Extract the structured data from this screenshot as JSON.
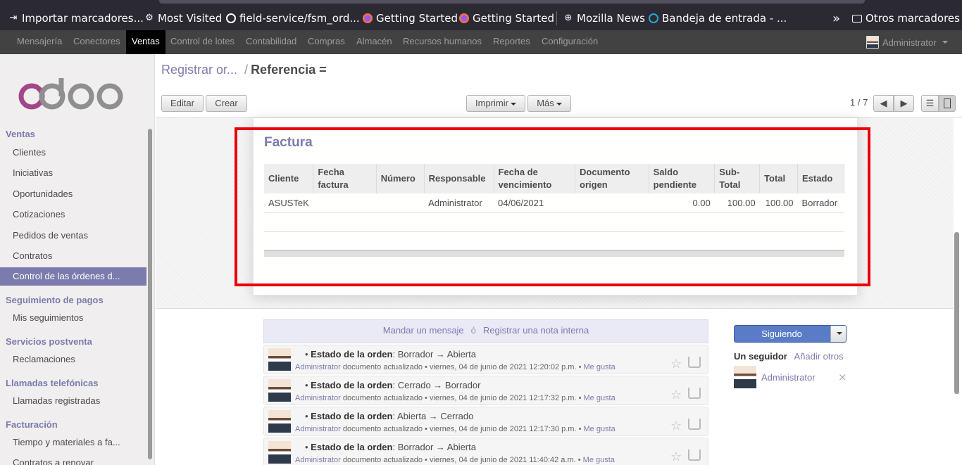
{
  "bookmarks": [
    {
      "label": "Importar marcadores...",
      "icon": "import-icon"
    },
    {
      "label": "Most Visited",
      "icon": "gear-icon"
    },
    {
      "label": "field-service/fsm_ord...",
      "icon": "github-icon"
    },
    {
      "label": "Getting Started",
      "icon": "firefox-icon"
    },
    {
      "label": "Getting Started",
      "icon": "firefox-icon"
    },
    {
      "label": "Mozilla News",
      "icon": "globe-icon"
    },
    {
      "label": "Bandeja de entrada - ...",
      "icon": "mail-icon"
    }
  ],
  "bookmarks_overflow": "»",
  "other_bookmarks": "Otros marcadores",
  "topmenu": [
    "Mensajería",
    "Conectores",
    "Ventas",
    "Control de lotes",
    "Contabilidad",
    "Compras",
    "Almacén",
    "Recursos humanos",
    "Reportes",
    "Configuración"
  ],
  "topmenu_active": "Ventas",
  "user": "Administrator",
  "sidebar": {
    "sections": [
      {
        "title": "Ventas",
        "items": [
          "Clientes",
          "Iniciativas",
          "Oportunidades",
          "Cotizaciones",
          "Pedidos de ventas",
          "Contratos",
          "Control de las órdenes d..."
        ]
      },
      {
        "title": "Seguimiento de pagos",
        "items": [
          "Mis seguimientos"
        ]
      },
      {
        "title": "Servicios postventa",
        "items": [
          "Reclamaciones"
        ]
      },
      {
        "title": "Llamadas telefónicas",
        "items": [
          "Llamadas registradas"
        ]
      },
      {
        "title": "Facturación",
        "items": [
          "Tiempo y materiales a fa...",
          "Contratos a renovar"
        ]
      }
    ],
    "active_item": "Control de las órdenes d..."
  },
  "breadcrumb": {
    "parent": "Registrar or...",
    "sep": "/",
    "current": "Referencia ="
  },
  "buttons": {
    "edit": "Editar",
    "create": "Crear",
    "print": "Imprimir",
    "more": "Más"
  },
  "pager": "1 / 7",
  "invoice": {
    "title": "Factura",
    "columns": [
      [
        "Cliente"
      ],
      [
        "Fecha",
        "factura"
      ],
      [
        "Número"
      ],
      [
        "Responsable"
      ],
      [
        "Fecha de",
        "vencimiento"
      ],
      [
        "Documento",
        "origen"
      ],
      [
        "Saldo",
        "pendiente"
      ],
      [
        "Sub-",
        "Total"
      ],
      [
        "Total"
      ],
      [
        "Estado"
      ]
    ],
    "rows": [
      [
        "ASUSTeK",
        "",
        "",
        "Administrator",
        "04/06/2021",
        "",
        "0.00",
        "100.00",
        "100.00",
        "Borrador"
      ]
    ]
  },
  "chatter": {
    "send": "Mandar un mensaje",
    "or": "ó",
    "note": "Registrar una nota interna"
  },
  "messages": [
    {
      "field": "Estado de la orden",
      "change": ": Borrador → Abierta",
      "author": "Administrator",
      "action": "documento actualizado",
      "date": "viernes, 04 de junio de 2021 12:20:02 p.m.",
      "like": "Me gusta"
    },
    {
      "field": "Estado de la orden",
      "change": ": Cerrado → Borrador",
      "author": "Administrator",
      "action": "documento actualizado",
      "date": "viernes, 04 de junio de 2021 12:17:32 p.m.",
      "like": "Me gusta"
    },
    {
      "field": "Estado de la orden",
      "change": ": Abierta → Cerrado",
      "author": "Administrator",
      "action": "documento actualizado",
      "date": "viernes, 04 de junio de 2021 12:17:30 p.m.",
      "like": "Me gusta"
    },
    {
      "field": "Estado de la orden",
      "change": ": Borrador → Abierta",
      "author": "Administrator",
      "action": "documento actualizado",
      "date": "viernes, 04 de junio de 2021 11:40:42 a.m.",
      "like": "Me gusta"
    }
  ],
  "followers": {
    "button": "Siguiendo",
    "count_label": "Un seguidor",
    "add": "Añadir otros",
    "list": [
      "Administrator"
    ],
    "remove": "×"
  },
  "colors": {
    "accent": "#7c7bad",
    "topbar": "#424242",
    "highlight": "#e8000b",
    "follow_button": "#5a7bc6"
  }
}
